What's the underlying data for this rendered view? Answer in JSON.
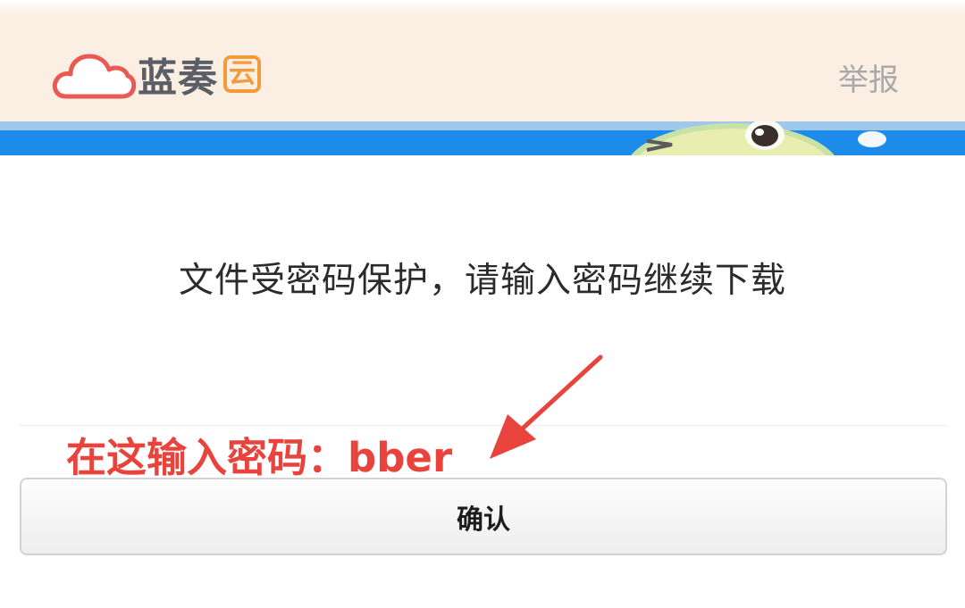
{
  "header": {
    "logo_text": "蓝奏",
    "logo_badge": "云",
    "report_label": "举报"
  },
  "main": {
    "prompt": "文件受密码保护，请输入密码继续下载",
    "password_value": "",
    "confirm_label": "确认"
  },
  "annotation": {
    "text": "在这输入密码：bber"
  },
  "colors": {
    "header_bg": "#fbeee3",
    "banner_blue": "#1c8bea",
    "brand_orange": "#f39a3a",
    "annotation_red": "#e8433d",
    "logo_gray": "#5a5f66"
  },
  "icons": {
    "logo": "cloud-icon",
    "annotation": "arrow-icon"
  }
}
